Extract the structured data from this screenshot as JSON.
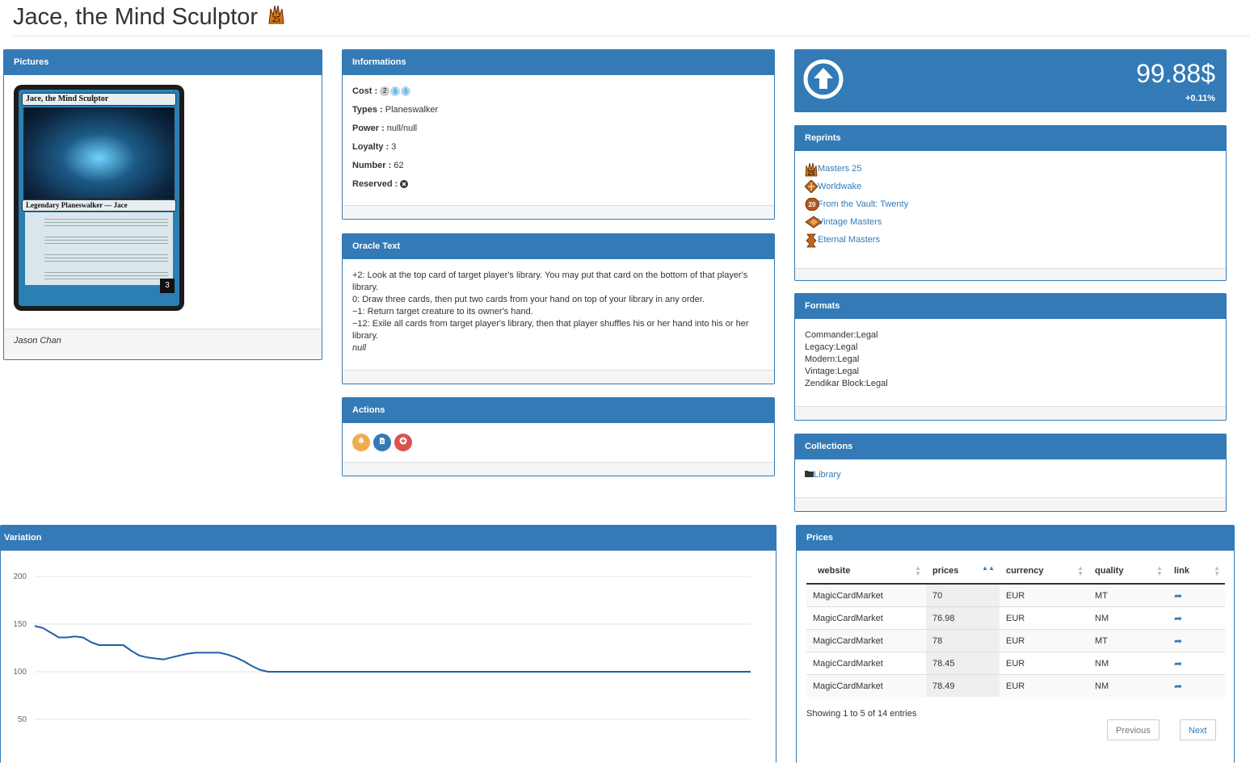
{
  "title": "Jace, the Mind Sculptor",
  "title_set_icon": "masters-25-set-icon",
  "pictures": {
    "heading": "Pictures",
    "card_name": "Jace, the Mind Sculptor",
    "card_type_line": "Legendary Planeswalker — Jace",
    "card_loyalty": "3",
    "artist": "Jason Chan"
  },
  "informations": {
    "heading": "Informations",
    "cost_label": "Cost :",
    "types_label": "Types :",
    "types_value": "Planeswalker",
    "power_label": "Power :",
    "power_value": "null/null",
    "loyalty_label": "Loyalty :",
    "loyalty_value": "3",
    "number_label": "Number :",
    "number_value": "62",
    "reserved_label": "Reserved :",
    "cost_symbols": [
      "2",
      "U",
      "U"
    ]
  },
  "oracle": {
    "heading": "Oracle Text",
    "lines": [
      "+2: Look at the top card of target player's library. You may put that card on the bottom of that player's",
      "library.",
      "0: Draw three cards, then put two cards from your hand on top of your library in any order.",
      "−1: Return target creature to its owner's hand.",
      "−12: Exile all cards from target player's library, then that player shuffles his or her hand into his or her",
      "library."
    ],
    "flavor": "null"
  },
  "actions": {
    "heading": "Actions",
    "buttons": [
      {
        "icon": "bell-icon",
        "color": "#f0ad4e"
      },
      {
        "icon": "file-icon",
        "color": "#337ab7"
      },
      {
        "icon": "plus-circle-icon",
        "color": "#d9534f"
      }
    ]
  },
  "price_box": {
    "value": "99.88$",
    "delta": "+0.11%",
    "icon": "arrow-up-circle-icon"
  },
  "reprints": {
    "heading": "Reprints",
    "items": [
      "Masters 25",
      "Worldwake",
      "From the Vault: Twenty",
      "Vintage Masters",
      "Eternal Masters"
    ]
  },
  "formats": {
    "heading": "Formats",
    "items": [
      "Commander:Legal",
      "Legacy:Legal",
      "Modern:Legal",
      "Vintage:Legal",
      "Zendikar Block:Legal"
    ]
  },
  "collections": {
    "heading": "Collections",
    "items": [
      "Library"
    ]
  },
  "variation": {
    "heading": "Variation"
  },
  "chart_data": {
    "type": "line",
    "ylim": [
      50,
      200
    ],
    "yticks": [
      200,
      150,
      100,
      50
    ],
    "grid": true,
    "series": [
      {
        "values": [
          148,
          146,
          141,
          136,
          136,
          137,
          136,
          131,
          128,
          128,
          128,
          128,
          122,
          117,
          115,
          114,
          113,
          115,
          117,
          119,
          120,
          120,
          120,
          120,
          118,
          115,
          111,
          106,
          102,
          100,
          100,
          100,
          100,
          100,
          100,
          100,
          100,
          100,
          100,
          100,
          100,
          100,
          100,
          100,
          100,
          100,
          100,
          100,
          100,
          100,
          100,
          100,
          100,
          100,
          100,
          100,
          100,
          100,
          100,
          100,
          100,
          100,
          100,
          100,
          100,
          100,
          100,
          100,
          100,
          100,
          100,
          100,
          100,
          100,
          100,
          100,
          100,
          100,
          100,
          100,
          100,
          100,
          100,
          100,
          100,
          100,
          100,
          100,
          100,
          100
        ],
        "color": "#1f5fa8"
      }
    ]
  },
  "prices": {
    "heading": "Prices",
    "columns": [
      "website",
      "prices",
      "currency",
      "quality",
      "link"
    ],
    "rows": [
      [
        "MagicCardMarket",
        "70",
        "EUR",
        "MT"
      ],
      [
        "MagicCardMarket",
        "76.98",
        "EUR",
        "NM"
      ],
      [
        "MagicCardMarket",
        "78",
        "EUR",
        "MT"
      ],
      [
        "MagicCardMarket",
        "78.45",
        "EUR",
        "NM"
      ],
      [
        "MagicCardMarket",
        "78.49",
        "EUR",
        "NM"
      ]
    ],
    "info": "Showing 1 to 5 of 14 entries",
    "previous": "Previous",
    "next": "Next"
  }
}
